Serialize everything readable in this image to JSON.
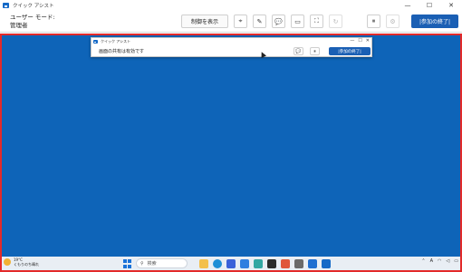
{
  "window": {
    "title": "クイック アシスト",
    "controls": {
      "minimize": "—",
      "maximize": "☐",
      "close": "✕"
    }
  },
  "toolbar": {
    "mode_label": "ユーザー モード:",
    "mode_value": "管理者",
    "show_control_label": "制御を表示",
    "tools": [
      {
        "name": "laser-pointer-icon",
        "glyph": "⌖",
        "enabled": true
      },
      {
        "name": "annotate-icon",
        "glyph": "✎",
        "enabled": true
      },
      {
        "name": "chat-icon",
        "glyph": "💬",
        "enabled": true
      },
      {
        "name": "monitor-icon",
        "glyph": "▭",
        "enabled": true
      },
      {
        "name": "fullscreen-icon",
        "glyph": "⛶",
        "enabled": true
      },
      {
        "name": "restart-icon",
        "glyph": "↻",
        "enabled": false
      },
      {
        "name": "pause-icon",
        "glyph": "⏸",
        "enabled": true
      },
      {
        "name": "settings-icon",
        "glyph": "⚙",
        "enabled": false
      }
    ],
    "end_label": "|参加の終了|"
  },
  "remote": {
    "window_title": "クイック アシスト",
    "sharing_text": "画面の共有は有効です",
    "chat_glyph": "💬",
    "pause_glyph": "⏸",
    "end_label": "|参加の終了|",
    "controls": {
      "minimize": "—",
      "maximize": "☐",
      "close": "✕"
    }
  },
  "taskbar": {
    "temperature": "19°C",
    "weather": "くもりのち晴れ",
    "search_placeholder": "検索",
    "tray_text": "A",
    "apps": [
      {
        "name": "file-explorer-icon",
        "color": "#f3c04b"
      },
      {
        "name": "edge-browser-icon",
        "color": "#1e8fd6"
      },
      {
        "name": "store-icon",
        "color": "#3b62d9"
      },
      {
        "name": "mail-icon",
        "color": "#2f7fe0"
      },
      {
        "name": "photos-icon",
        "color": "#32a7a2"
      },
      {
        "name": "terminal-icon",
        "color": "#2b2b2b"
      },
      {
        "name": "office-icon",
        "color": "#e0573a"
      },
      {
        "name": "settings-app-icon",
        "color": "#6a6a6a"
      },
      {
        "name": "calendar-icon",
        "color": "#1f6fd1"
      },
      {
        "name": "quick-assist-taskbar-icon",
        "color": "#1469c7"
      }
    ]
  }
}
